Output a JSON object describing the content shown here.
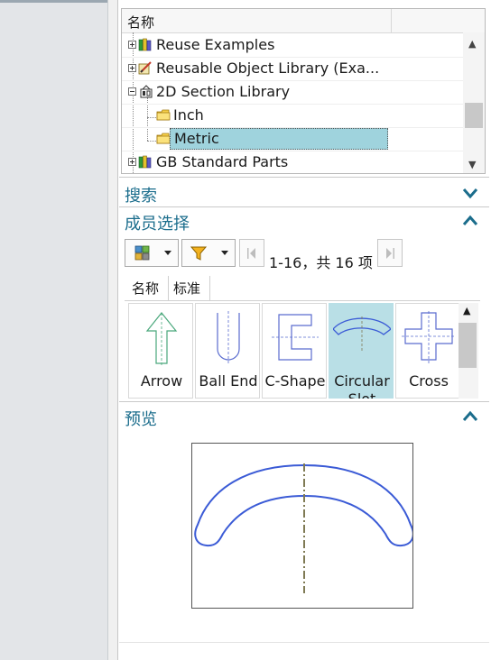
{
  "tree": {
    "column_header": "名称",
    "rows": [
      {
        "label": "Reuse Examples",
        "icon": "library-books-icon",
        "expander": "plus"
      },
      {
        "label": "Reusable Object Library (Exa...",
        "icon": "pencil-library-icon",
        "expander": "plus"
      },
      {
        "label": "2D Section Library",
        "icon": "section-library-icon",
        "expander": "minus"
      },
      {
        "label": "Inch",
        "icon": "folder-icon"
      },
      {
        "label": "Metric",
        "icon": "folder-icon",
        "selected": true
      },
      {
        "label": "GB Standard Parts",
        "icon": "library-books-icon",
        "expander": "plus"
      }
    ]
  },
  "search": {
    "title": "搜索",
    "state": "collapsed",
    "chevron": "chevron-down-icon"
  },
  "member_select": {
    "title": "成员选择",
    "state": "expanded",
    "chevron": "chevron-up-icon",
    "page_info": "1-16，共 16 项",
    "list_headers": [
      "名称",
      "标准"
    ],
    "items": [
      {
        "label": "Arrow"
      },
      {
        "label": "Ball End"
      },
      {
        "label": "C-Shape"
      },
      {
        "label": "Circular Slot",
        "selected": true
      },
      {
        "label": "Cross"
      }
    ]
  },
  "preview": {
    "title": "预览",
    "state": "expanded",
    "chevron": "chevron-up-icon",
    "shape": "circular-slot"
  },
  "colors": {
    "accent": "#1b6d8c",
    "selection": "#9fd3dd",
    "shape_stroke": "#3b5bd6",
    "centerline": "#7f7a54"
  }
}
